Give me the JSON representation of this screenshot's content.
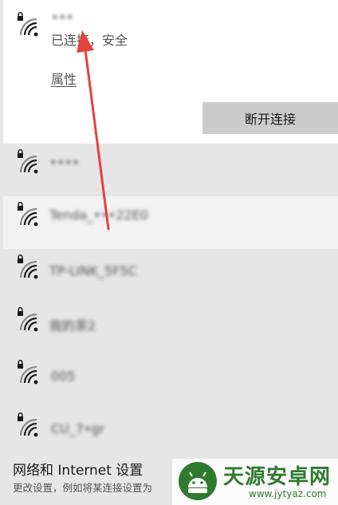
{
  "connected": {
    "ssid": "•••",
    "status": "已连接，安全",
    "properties_label": "属性",
    "disconnect_label": "断开连接",
    "icon": "wifi-secured-icon"
  },
  "networks": [
    {
      "ssid": "••••",
      "icon": "wifi-secured-icon",
      "blurred": true
    },
    {
      "ssid": "Tenda_•••22E0",
      "icon": "wifi-secured-icon",
      "blurred": true
    },
    {
      "ssid": "TP-LINK_5F5C",
      "icon": "wifi-secured-icon",
      "blurred": true
    },
    {
      "ssid": "我的茶2",
      "icon": "wifi-secured-icon",
      "blurred": true
    },
    {
      "ssid": "005",
      "icon": "wifi-secured-icon",
      "blurred": true
    },
    {
      "ssid": "CU_7•gr",
      "icon": "wifi-secured-icon",
      "blurred": true
    }
  ],
  "footer": {
    "title": "网络和 Internet 设置",
    "subtitle": "更改设置，例如将某连接设置为"
  },
  "watermark": {
    "title": "天源安卓网",
    "url": "www.jytyaz.com"
  },
  "colors": {
    "list_bg": "#e6e6e6",
    "connected_bg": "#ffffff",
    "button_bg": "#cccccc",
    "annotation_arrow": "#e8403a",
    "watermark_green": "#2f7a2f"
  }
}
